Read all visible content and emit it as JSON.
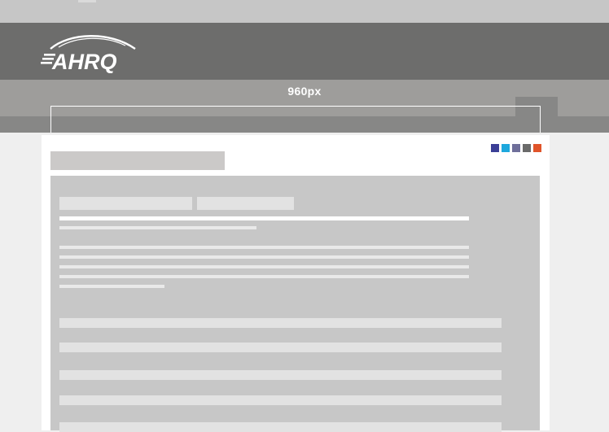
{
  "header": {
    "logo_text": "AHRQ",
    "background": "#6d6d6c"
  },
  "width_band": {
    "label": "960px"
  },
  "swatches": [
    {
      "name": "navy",
      "color": "#3b3f96"
    },
    {
      "name": "cyan",
      "color": "#1ea8dd"
    },
    {
      "name": "slate",
      "color": "#6f6f9a"
    },
    {
      "name": "gray",
      "color": "#6a6a6a"
    },
    {
      "name": "orange",
      "color": "#e0542a"
    }
  ]
}
